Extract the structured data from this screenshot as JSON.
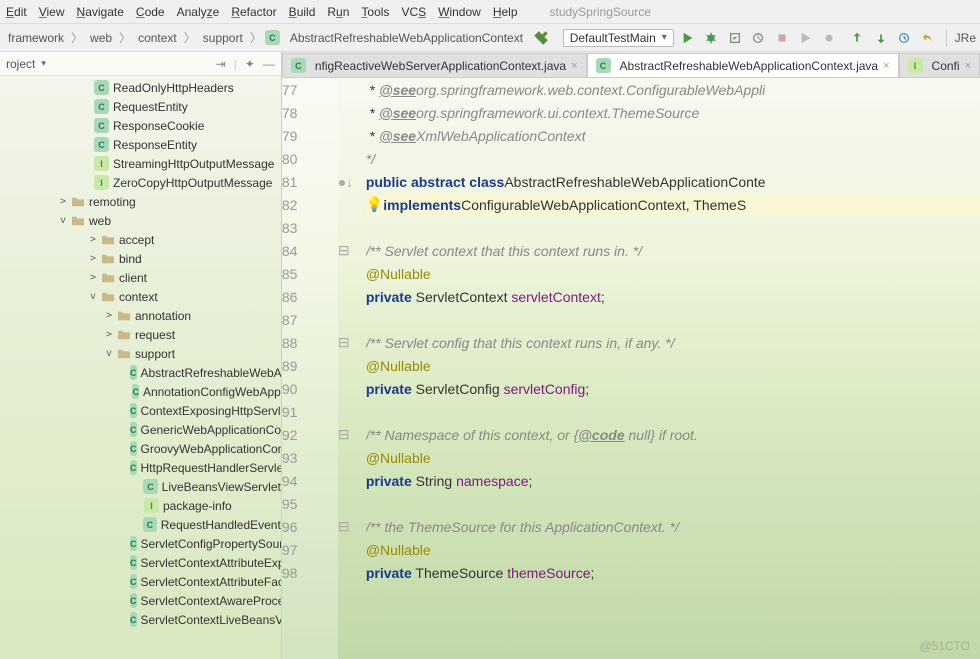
{
  "menu": [
    "Edit",
    "View",
    "Navigate",
    "Code",
    "Analyze",
    "Refactor",
    "Build",
    "Run",
    "Tools",
    "VCS",
    "Window",
    "Help"
  ],
  "projectName": "studySpringSource",
  "breadcrumb": [
    "framework",
    "web",
    "context",
    "support",
    "AbstractRefreshableWebApplicationContext"
  ],
  "runConfig": "DefaultTestMain",
  "toolbarRight": "JRe",
  "sidebar": {
    "title": "roject",
    "items_top": [
      {
        "icon": "c",
        "label": "ReadOnlyHttpHeaders"
      },
      {
        "icon": "c",
        "label": "RequestEntity"
      },
      {
        "icon": "c",
        "label": "ResponseCookie"
      },
      {
        "icon": "c",
        "label": "ResponseEntity"
      },
      {
        "icon": "i",
        "label": "StreamingHttpOutputMessage"
      },
      {
        "icon": "i",
        "label": "ZeroCopyHttpOutputMessage"
      }
    ],
    "pkg_remoting": "remoting",
    "pkg_web": "web",
    "web_children": [
      "accept",
      "bind",
      "client"
    ],
    "context_label": "context",
    "context_children": [
      "annotation",
      "request"
    ],
    "support_label": "support",
    "support_items": [
      {
        "icon": "c",
        "label": "AbstractRefreshableWebA"
      },
      {
        "icon": "c",
        "label": "AnnotationConfigWebApp"
      },
      {
        "icon": "c",
        "label": "ContextExposingHttpServle"
      },
      {
        "icon": "c",
        "label": "GenericWebApplicationCo"
      },
      {
        "icon": "c",
        "label": "GroovyWebApplicationCon"
      },
      {
        "icon": "c",
        "label": "HttpRequestHandlerServle"
      },
      {
        "icon": "c",
        "label": "LiveBeansViewServlet"
      },
      {
        "icon": "i",
        "label": "package-info"
      },
      {
        "icon": "c",
        "label": "RequestHandledEvent"
      },
      {
        "icon": "c",
        "label": "ServletConfigPropertySour"
      },
      {
        "icon": "c",
        "label": "ServletContextAttributeExp"
      },
      {
        "icon": "c",
        "label": "ServletContextAttributeFac"
      },
      {
        "icon": "c",
        "label": "ServletContextAwareProce"
      },
      {
        "icon": "c",
        "label": "ServletContextLiveBeansVi"
      }
    ]
  },
  "tabs": [
    {
      "label": "nfigReactiveWebServerApplicationContext.java",
      "active": false,
      "icon": "c"
    },
    {
      "label": "AbstractRefreshableWebApplicationContext.java",
      "active": true,
      "icon": "c"
    },
    {
      "label": "Confi",
      "active": false,
      "icon": "i"
    }
  ],
  "code": {
    "startLine": 77,
    "lines": [
      {
        "n": 77,
        "html": " * <span class='cmtag'>@see</span> <span class='cm'>org.springframework.web.context.ConfigurableWebAppli</span>"
      },
      {
        "n": 78,
        "html": " * <span class='cmtag'>@see</span> <span class='cm'>org.springframework.ui.context.ThemeSource</span>"
      },
      {
        "n": 79,
        "html": " * <span class='cmtag'>@see</span> <span class='cm'>XmlWebApplicationContext</span>"
      },
      {
        "n": 80,
        "html": " <span class='cm'>*/</span>"
      },
      {
        "n": 81,
        "mark": "●↓",
        "html": "<span class='kw'>public abstract class</span> <span class='typ'>AbstractRefreshableWebApplicationConte</span>"
      },
      {
        "n": 82,
        "hl": true,
        "bulb": true,
        "html": "        <span class='kw'>implements</span> <span class='typ'>ConfigurableWebApplicationContext</span>, ThemeS"
      },
      {
        "n": 83,
        "html": ""
      },
      {
        "n": 84,
        "mark": "⊟",
        "html": "    <span class='cm'>/** Servlet context that this context runs in. */</span>"
      },
      {
        "n": 85,
        "html": "    <span class='ann'>@Nullable</span>"
      },
      {
        "n": 86,
        "html": "    <span class='kw'>private</span> ServletContext <span class='fld'>servletContext</span>;"
      },
      {
        "n": 87,
        "html": ""
      },
      {
        "n": 88,
        "mark": "⊟",
        "html": "    <span class='cm'>/** Servlet config that this context runs in, if any. */</span>"
      },
      {
        "n": 89,
        "html": "    <span class='ann'>@Nullable</span>"
      },
      {
        "n": 90,
        "html": "    <span class='kw'>private</span> ServletConfig <span class='fld'>servletConfig</span>;"
      },
      {
        "n": 91,
        "html": ""
      },
      {
        "n": 92,
        "mark": "⊟",
        "html": "    <span class='cm'>/** Namespace of this context, or {<span class='cmtag'>@code</span> null} if root. </span>"
      },
      {
        "n": 93,
        "html": "    <span class='ann'>@Nullable</span>"
      },
      {
        "n": 94,
        "html": "    <span class='kw'>private</span> String <span class='fld'>namespace</span>;"
      },
      {
        "n": 95,
        "html": ""
      },
      {
        "n": 96,
        "mark": "⊟",
        "html": "    <span class='cm'>/** the ThemeSource for this ApplicationContext. */</span>"
      },
      {
        "n": 97,
        "html": "    <span class='ann'>@Nullable</span>"
      },
      {
        "n": 98,
        "html": "    <span class='kw'>private</span> ThemeSource <span class='fld'>themeSource</span>;"
      }
    ]
  },
  "watermark": "@51CTO"
}
